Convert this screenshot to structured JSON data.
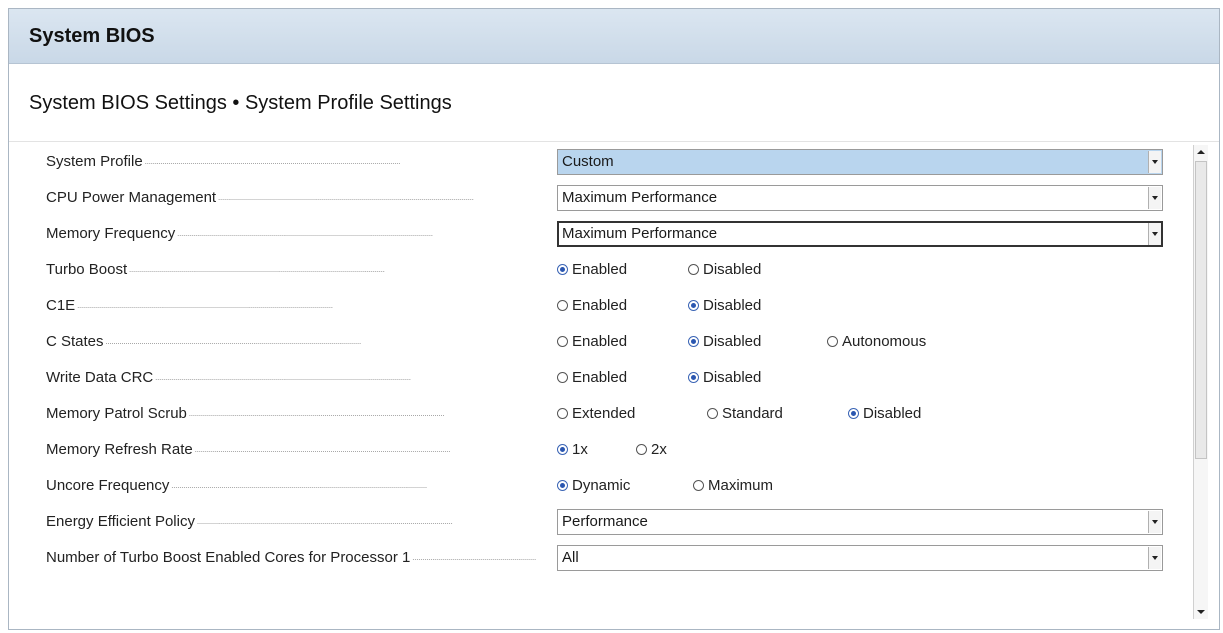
{
  "window": {
    "title": "System BIOS",
    "subtitle": "System BIOS Settings • System Profile Settings"
  },
  "settings": {
    "system_profile": {
      "label": "System Profile",
      "value": "Custom"
    },
    "cpu_power_management": {
      "label": "CPU Power Management",
      "value": "Maximum Performance"
    },
    "memory_frequency": {
      "label": "Memory Frequency",
      "value": "Maximum Performance"
    },
    "turbo_boost": {
      "label": "Turbo Boost",
      "options": [
        "Enabled",
        "Disabled"
      ],
      "selected": "Enabled"
    },
    "c1e": {
      "label": "C1E",
      "options": [
        "Enabled",
        "Disabled"
      ],
      "selected": "Disabled"
    },
    "c_states": {
      "label": "C States",
      "options": [
        "Enabled",
        "Disabled",
        "Autonomous"
      ],
      "selected": "Disabled"
    },
    "write_data_crc": {
      "label": "Write Data CRC",
      "options": [
        "Enabled",
        "Disabled"
      ],
      "selected": "Disabled"
    },
    "memory_patrol_scrub": {
      "label": "Memory Patrol Scrub",
      "options": [
        "Extended",
        "Standard",
        "Disabled"
      ],
      "selected": "Disabled"
    },
    "memory_refresh_rate": {
      "label": "Memory Refresh Rate",
      "options": [
        "1x",
        "2x"
      ],
      "selected": "1x"
    },
    "uncore_frequency": {
      "label": "Uncore Frequency",
      "options": [
        "Dynamic",
        "Maximum"
      ],
      "selected": "Dynamic"
    },
    "energy_efficient_policy": {
      "label": "Energy Efficient Policy",
      "value": "Performance"
    },
    "turbo_boost_cores": {
      "label": "Number of Turbo Boost Enabled Cores for Processor 1",
      "value": "All"
    }
  },
  "icons": {
    "dropdown": "chevron-down-icon",
    "radio_selected": "radio-selected-icon",
    "radio_unselected": "radio-unselected-icon",
    "scroll_up": "scroll-up-icon",
    "scroll_down": "scroll-down-icon"
  },
  "colors": {
    "title_bar": "#c9d8e7",
    "highlight": "#b9d5ee",
    "radio_accent": "#2a56b0"
  }
}
